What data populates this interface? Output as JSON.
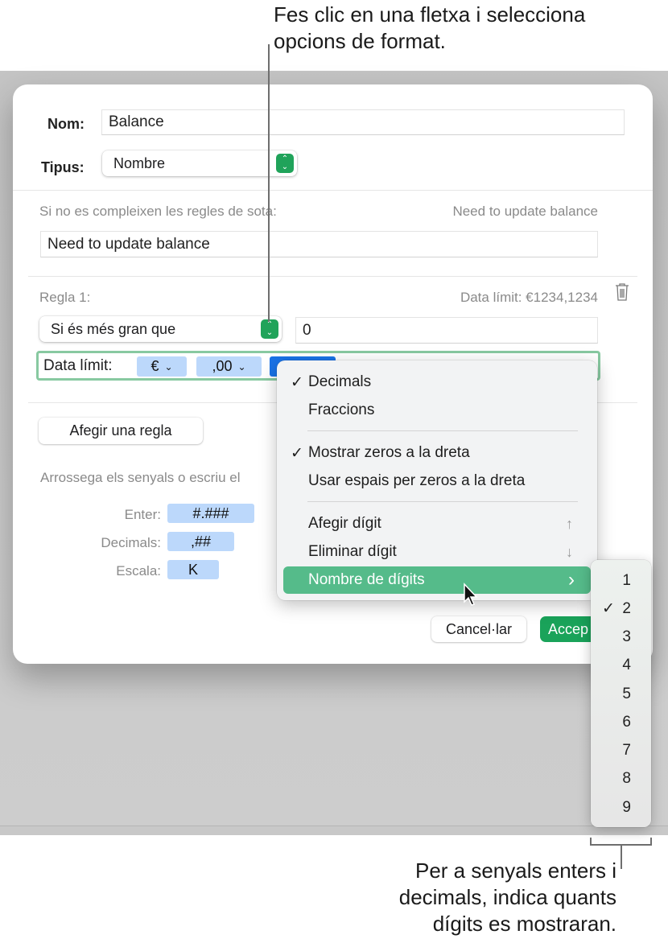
{
  "callouts": {
    "top": [
      "Fes clic en una fletxa i selecciona",
      "opcions de format."
    ],
    "bottom": [
      "Per a senyals enters i",
      "decimals, indica quants",
      "dígits es mostraran."
    ]
  },
  "dialog": {
    "name_label": "Nom:",
    "name_value": "Balance",
    "type_label": "Tipus:",
    "type_value": "Nombre",
    "fallback_label": "Si no es compleixen les regles de sota:",
    "fallback_preview": "Need to update balance",
    "fallback_value": "Need to update balance",
    "rule": {
      "title": "Regla 1:",
      "preview": "Data límit: €1234,1234",
      "condition": "Si és més gran que",
      "condition_value": "0",
      "format_label": "Data límit:",
      "tokens": [
        "€",
        ",00",
        ",00"
      ]
    },
    "add_rule_label": "Afegir una regla",
    "instructions": "Arrossega els senyals o escriu el",
    "token_rows": [
      {
        "label": "Enter:",
        "token": "#.###"
      },
      {
        "label": "Decimals:",
        "token": ",##"
      },
      {
        "label": "Escala:",
        "token": "K"
      }
    ],
    "cancel_label": "Cancel·lar",
    "accept_label": "Accep"
  },
  "menu": {
    "items": [
      {
        "label": "Decimals",
        "checked": "✓"
      },
      {
        "label": "Fraccions",
        "checked": ""
      },
      {
        "label": "Mostrar zeros a la dreta",
        "checked": "✓"
      },
      {
        "label": "Usar espais per zeros a la dreta",
        "checked": ""
      },
      {
        "label": "Afegir dígit",
        "shortcut": "↑"
      },
      {
        "label": "Eliminar dígit",
        "shortcut": "↓"
      },
      {
        "label": "Nombre de dígits",
        "arrow": "›"
      }
    ]
  },
  "submenu": {
    "items": [
      "1",
      "2",
      "3",
      "4",
      "5",
      "6",
      "7",
      "8",
      "9"
    ],
    "selected": "2",
    "check": "✓"
  },
  "colors": {
    "accent_green": "#20a35a",
    "menu_highlight": "#55bb8a",
    "token_blue": "#bcd8fb",
    "selected_token": "#1a73e8"
  }
}
